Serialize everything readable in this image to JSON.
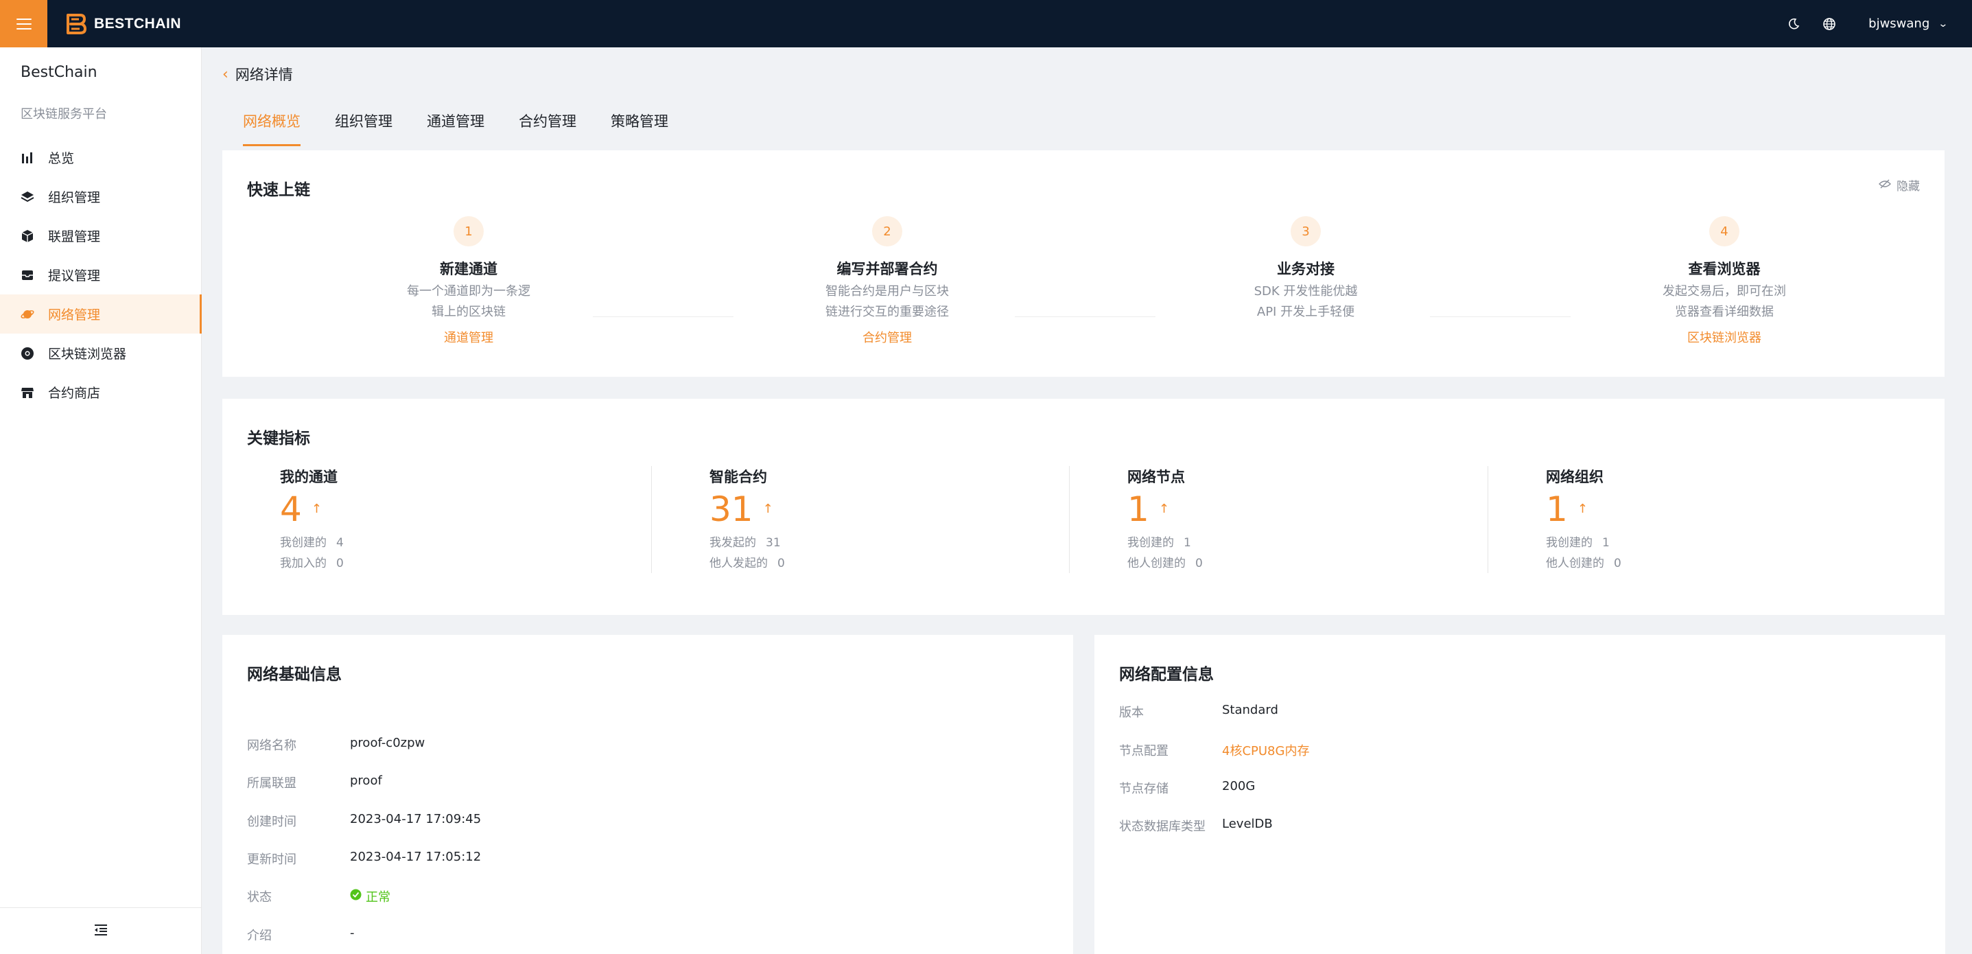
{
  "topbar": {
    "brand": "BESTCHAIN",
    "user": "bjwswang",
    "icons": [
      "menu-icon",
      "theme-moon-icon",
      "language-globe-icon",
      "chevron-down-icon"
    ]
  },
  "sidebar": {
    "title": "BestChain",
    "subtitle": "区块链服务平台",
    "items": [
      {
        "label": "总览",
        "icon": "bar-chart-icon"
      },
      {
        "label": "组织管理",
        "icon": "layers-icon"
      },
      {
        "label": "联盟管理",
        "icon": "cube-icon"
      },
      {
        "label": "提议管理",
        "icon": "inbox-icon"
      },
      {
        "label": "网络管理",
        "icon": "planet-icon"
      },
      {
        "label": "区块链浏览器",
        "icon": "chrome-icon"
      },
      {
        "label": "合约商店",
        "icon": "shop-icon"
      }
    ],
    "active_index": 4
  },
  "page": {
    "back_label": "网络详情",
    "tabs": [
      "网络概览",
      "组织管理",
      "通道管理",
      "合约管理",
      "策略管理"
    ],
    "active_tab": 0
  },
  "quick_start": {
    "title": "快速上链",
    "hide_label": "隐藏",
    "steps": [
      {
        "num": "1",
        "title": "新建通道",
        "desc1": "每一个通道即为一条逻",
        "desc2": "辑上的区块链",
        "link": "通道管理"
      },
      {
        "num": "2",
        "title": "编写并部署合约",
        "desc1": "智能合约是用户与区块",
        "desc2": "链进行交互的重要途径",
        "link": "合约管理"
      },
      {
        "num": "3",
        "title": "业务对接",
        "desc1": "SDK 开发性能优越",
        "desc2": "API 开发上手轻便",
        "link": ""
      },
      {
        "num": "4",
        "title": "查看浏览器",
        "desc1": "发起交易后，即可在浏",
        "desc2": "览器查看详细数据",
        "link": "区块链浏览器"
      }
    ]
  },
  "metrics": {
    "title": "关键指标",
    "items": [
      {
        "title": "我的通道",
        "value": "4",
        "arrow": "↑",
        "row1_label": "我创建的",
        "row1_value": "4",
        "row2_label": "我加入的",
        "row2_value": "0"
      },
      {
        "title": "智能合约",
        "value": "31",
        "arrow": "↑",
        "row1_label": "我发起的",
        "row1_value": "31",
        "row2_label": "他人发起的",
        "row2_value": "0"
      },
      {
        "title": "网络节点",
        "value": "1",
        "arrow": "↑",
        "row1_label": "我创建的",
        "row1_value": "1",
        "row2_label": "他人创建的",
        "row2_value": "0"
      },
      {
        "title": "网络组织",
        "value": "1",
        "arrow": "↑",
        "row1_label": "我创建的",
        "row1_value": "1",
        "row2_label": "他人创建的",
        "row2_value": "0"
      }
    ]
  },
  "basic_info": {
    "title": "网络基础信息",
    "rows": [
      {
        "k": "网络名称",
        "v": "proof-c0zpw"
      },
      {
        "k": "所属联盟",
        "v": "proof"
      },
      {
        "k": "创建时间",
        "v": "2023-04-17 17:09:45"
      },
      {
        "k": "更新时间",
        "v": "2023-04-17 17:05:12"
      },
      {
        "k": "状态",
        "v": "正常"
      },
      {
        "k": "介绍",
        "v": "-"
      }
    ]
  },
  "config_info": {
    "title": "网络配置信息",
    "rows": [
      {
        "k": "版本",
        "v": "Standard"
      },
      {
        "k": "节点配置",
        "v": "4核CPU8G内存"
      },
      {
        "k": "节点存储",
        "v": "200G"
      },
      {
        "k": "状态数据库类型",
        "v": "LevelDB"
      }
    ]
  },
  "colors": {
    "accent": "#f28b2c",
    "topbar": "#0c1a2d",
    "success": "#52c41a"
  }
}
